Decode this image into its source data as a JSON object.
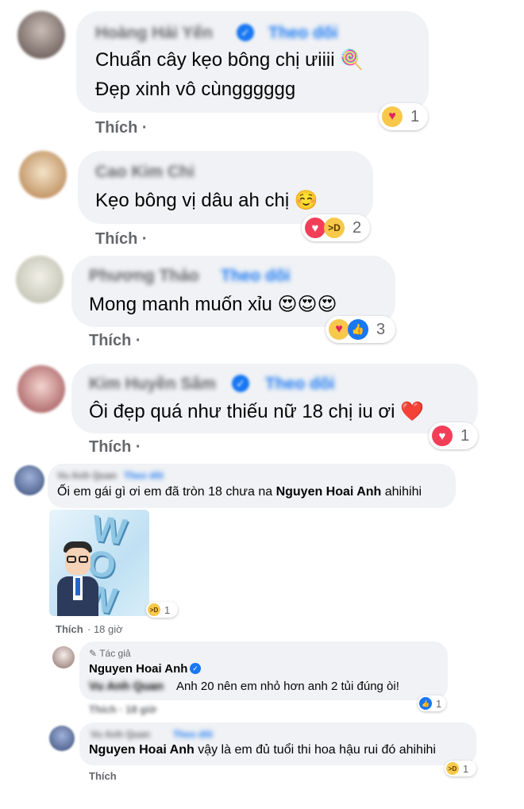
{
  "comments": [
    {
      "author": "Hoàng Hải Yến",
      "follow": "Theo dõi",
      "line1": "Chuẩn cây kẹo bông chị ưiiii 🍭",
      "line2": "Đẹp xinh vô cùngggggg",
      "like": "Thích ·",
      "reactions": [
        "care"
      ],
      "count": "1"
    },
    {
      "author": "Cao Kim Chi",
      "line1": "Kẹo bông vị dâu ah chị ☺️",
      "like": "Thích ·",
      "reactions": [
        "heart",
        "haha"
      ],
      "count": "2"
    },
    {
      "author": "Phương Thảo",
      "follow": "Theo dõi",
      "line1": "Mong manh muốn xỉu 😍😍😍",
      "like": "Thích ·",
      "reactions": [
        "care",
        "thumb"
      ],
      "count": "3"
    },
    {
      "author": "Kim Huyền Sâm",
      "follow": "Theo dõi",
      "line1": "Ôi đẹp quá như thiếu nữ 18 chị iu ơi ❤️",
      "like": "Thích ·",
      "reactions": [
        "heart"
      ],
      "count": "1"
    }
  ],
  "thread": {
    "author": "Vu Anh Quan",
    "follow": "Theo dõi",
    "text_pre": "Ối em gái gì ơi em đã tròn 18 chưa na ",
    "mention": "Nguyen Hoai Anh",
    "text_post": " ahihihi",
    "sticker_text": "WOW",
    "sticker_count": "1",
    "like": "Thích",
    "time": "· 18 giờ"
  },
  "reply1": {
    "author_tag": "Tác giả",
    "author": "Nguyen Hoai Anh",
    "mention_blurred": "Vu Anh Quan",
    "text": "Anh 20 nên em nhỏ hơn anh 2 tủi đúng òi!",
    "count": "1",
    "like_blurred": "Thích · 18 giờ"
  },
  "reply2": {
    "author": "Vu Anh Quan",
    "follow": "Theo dõi",
    "mention": "Nguyen Hoai Anh",
    "text": " vậy là em đủ tuổi thi hoa hậu rui đó ahihihi",
    "count": "1",
    "like": "Thích"
  },
  "colors": {
    "bubble": "#f0f2f5",
    "meta": "#65676b",
    "link": "#1877f2",
    "text": "#050505"
  }
}
